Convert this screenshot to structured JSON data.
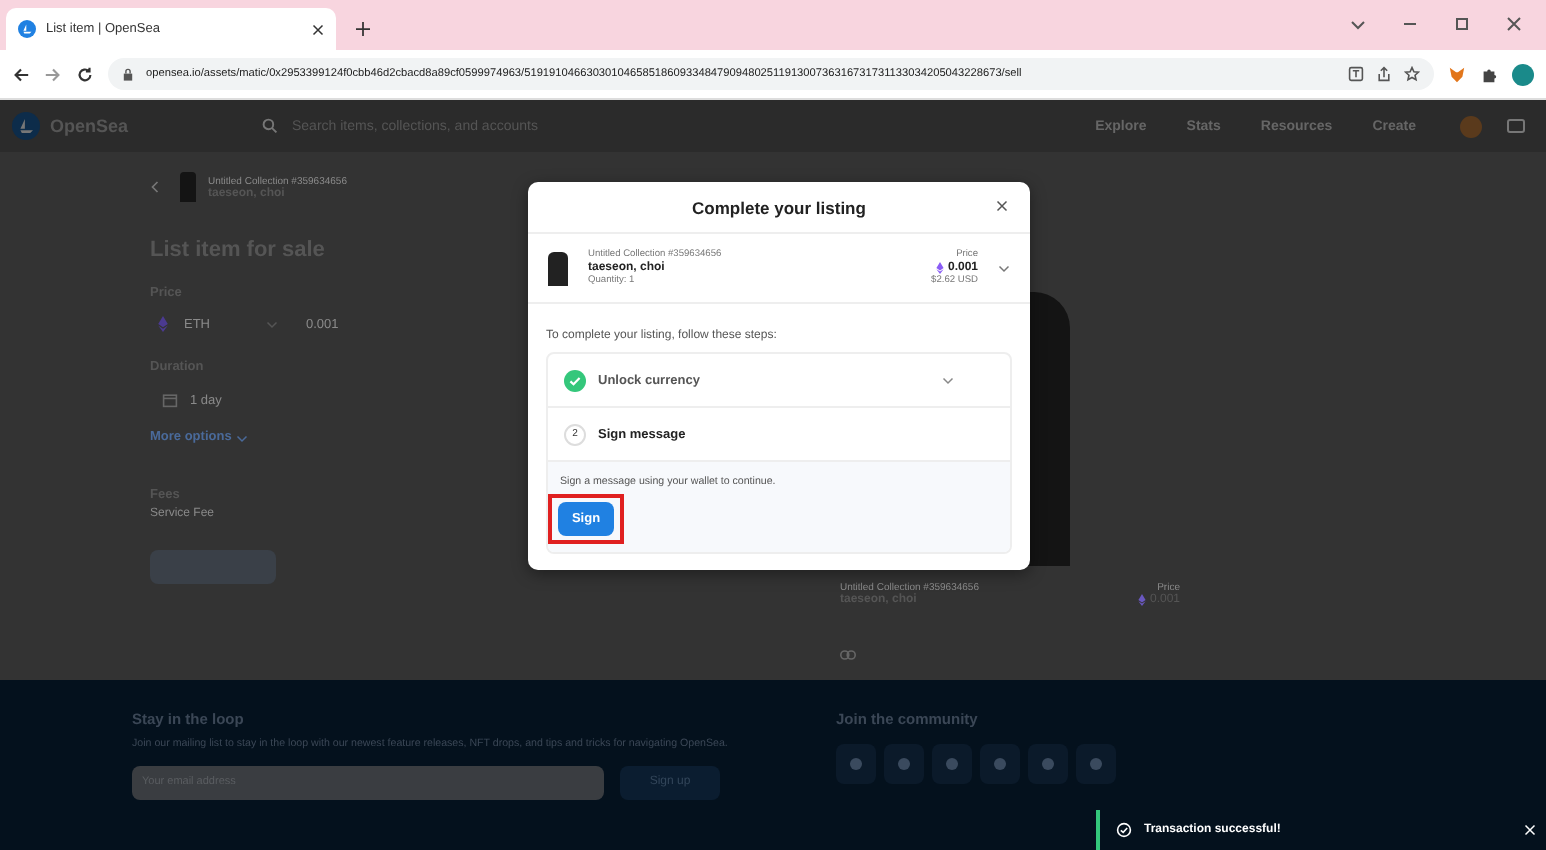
{
  "browser": {
    "tab_title": "List item | OpenSea",
    "url": "opensea.io/assets/matic/0x2953399124f0cbb46d2cbacd8a89cf0599974963/51919104663030104658518609334847909480251191300736316731731133034205043228673/sell"
  },
  "nav": {
    "brand": "OpenSea",
    "search_placeholder": "Search items, collections, and accounts",
    "links": [
      "Explore",
      "Stats",
      "Resources",
      "Create"
    ]
  },
  "listing": {
    "collection": "Untitled Collection #359634656",
    "item": "taeseon, choi",
    "heading": "List item for sale",
    "price_label": "Price",
    "currency": "ETH",
    "price": "0.001",
    "duration_label": "Duration",
    "duration": "1 day",
    "more_options": "More options",
    "fees_label": "Fees",
    "service_fee": "Service Fee"
  },
  "preview": {
    "collection": "Untitled Collection #359634656",
    "item": "taeseon, choi",
    "price_label": "Price",
    "price": "0.001"
  },
  "modal": {
    "title": "Complete your listing",
    "collection": "Untitled Collection #359634656",
    "item": "taeseon, choi",
    "quantity": "Quantity: 1",
    "price_label": "Price",
    "price": "0.001",
    "usd": "$2.62 USD",
    "instructions": "To complete your listing, follow these steps:",
    "steps": [
      {
        "kind": "done",
        "label": "Unlock currency",
        "expanded": false
      },
      {
        "kind": "numbered",
        "number": "2",
        "label": "Sign message",
        "expanded": true,
        "description": "Sign a message using your wallet to continue.",
        "button": "Sign"
      }
    ]
  },
  "footer": {
    "heading": "Stay in the loop",
    "text": "Join our mailing list to stay in the loop with our newest feature releases, NFT drops, and tips and tricks for navigating OpenSea.",
    "email_placeholder": "Your email address",
    "signup": "Sign up",
    "community": "Join the community"
  },
  "toast": {
    "text": "Transaction successful!"
  }
}
